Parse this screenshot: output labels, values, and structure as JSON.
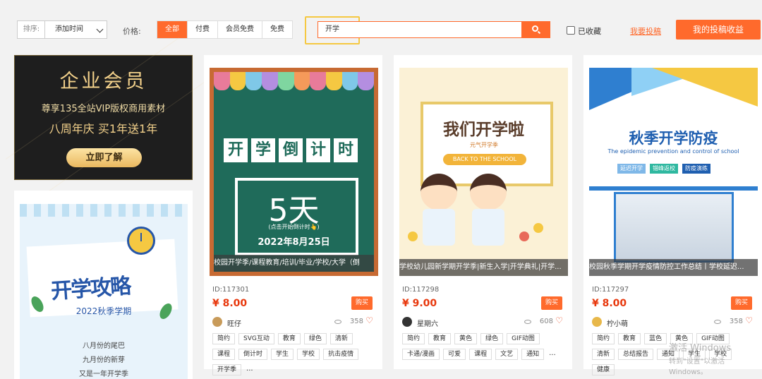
{
  "toolbar": {
    "sort_label": "排序:",
    "sort_value": "添加时间",
    "price_label": "价格:",
    "price_options": [
      "全部",
      "付费",
      "会员免费",
      "免费"
    ],
    "price_active": "全部",
    "search_value": "开学",
    "favorited_label": "已收藏",
    "submit_link": "我要投稿",
    "earnings_button": "我的投稿收益"
  },
  "vip_banner": {
    "title": "企业会员",
    "subtitle": "尊享135全站VIP版权商用素材",
    "promo": "八周年庆  买1年送1年",
    "button": "立即了解"
  },
  "poster": {
    "title": "开学攻略",
    "term": "2022秋季学期",
    "lines": [
      "八月份的尾巴",
      "九月份的新芽",
      "又是一年开学季"
    ]
  },
  "cards": [
    {
      "thumb": {
        "title_chars": [
          "开",
          "学",
          "倒",
          "计",
          "时"
        ],
        "big_number": "5天",
        "note": "(点击开始倒计时👆)",
        "date": "2022年8月25日"
      },
      "caption": "校园开学季/课程教育/培训/毕业/学校/大学（倒",
      "id": "ID:117301",
      "price": "¥ 8.00",
      "buy": "购买",
      "author": "旺仔",
      "views": "358",
      "tags": [
        "简约",
        "SVG互动",
        "教育",
        "绿色",
        "清新",
        "课程",
        "倒计时",
        "学生",
        "学校",
        "抗击疫情",
        "开学季"
      ]
    },
    {
      "thumb": {
        "headline": "我们开学啦",
        "sub": "元气开学季",
        "pill": "BACK TO THE SCHOOL"
      },
      "caption": "学校幼儿园新学期开学季|新生入学|开学典礼|开学...",
      "id": "ID:117298",
      "price": "¥ 9.00",
      "buy": "购买",
      "author": "星期六",
      "views": "608",
      "tags": [
        "简约",
        "教育",
        "黄色",
        "绿色",
        "GIF动图",
        "卡通/漫画",
        "可爱",
        "课程",
        "文艺",
        "通知"
      ]
    },
    {
      "thumb": {
        "headline": "秋季开学防疫",
        "english": "The epidemic prevention and control of school",
        "chips": [
          "延迟开学",
          "错峰返校",
          "防疫演练"
        ]
      },
      "caption": "校园秋季学期开学疫情防控工作总结丨学校延迟...",
      "id": "ID:117297",
      "price": "¥ 8.00",
      "buy": "购买",
      "author": "柠小萌",
      "views": "358",
      "tags": [
        "简约",
        "教育",
        "蓝色",
        "黄色",
        "GIF动图",
        "清新",
        "总结报告",
        "通知",
        "学生",
        "学校",
        "健康"
      ]
    }
  ],
  "more_symbol": "...",
  "heart_symbol": "♡",
  "watermark": {
    "line1": "激活 Windows",
    "line2": "转到\"设置\"以激活 Windows。"
  }
}
